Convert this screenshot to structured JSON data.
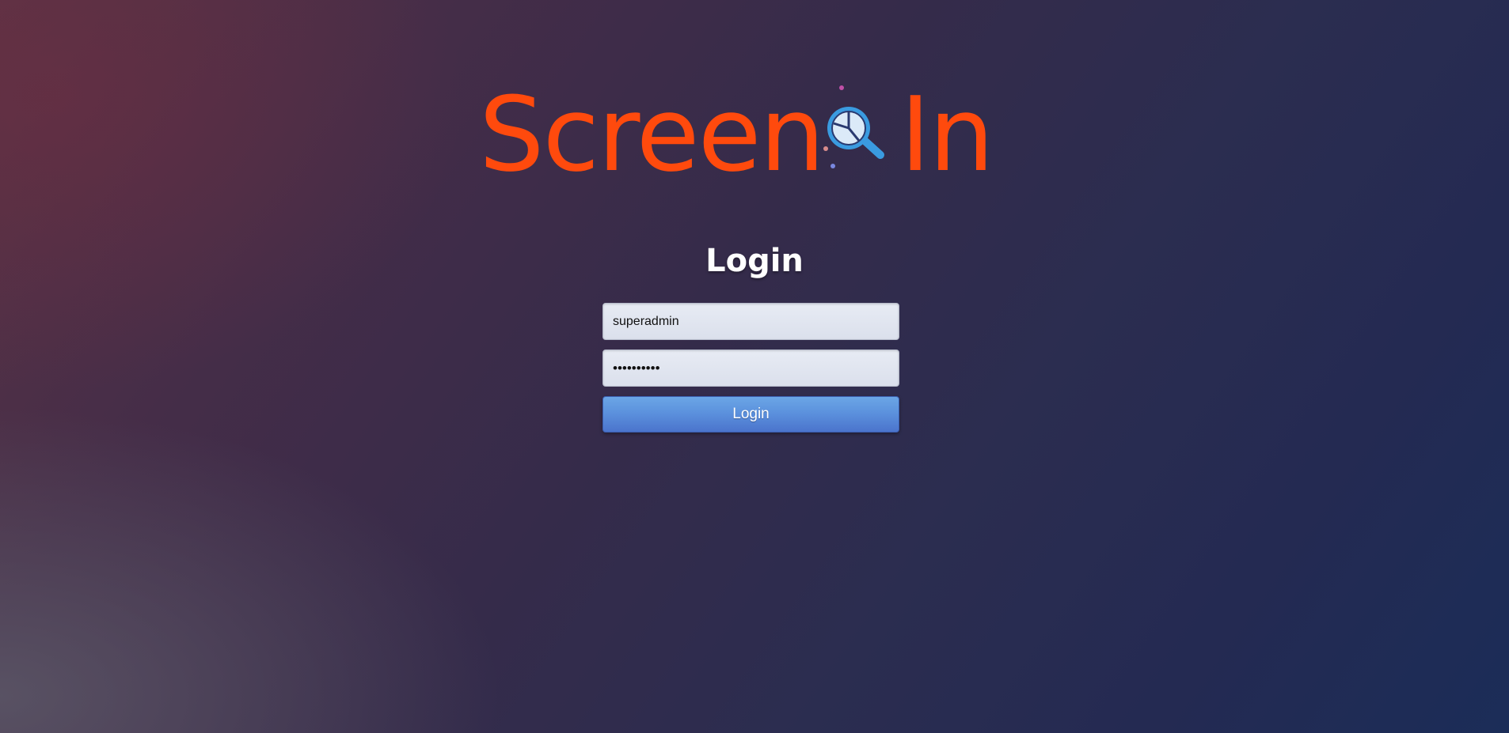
{
  "brand": {
    "word_left": "Screen",
    "word_right": "In",
    "logo_color": "#ff4a0d",
    "icon": "magnifier-pie-chart-icon"
  },
  "login": {
    "title": "Login",
    "username_value": "superadmin",
    "password_value": "••••••••••",
    "button_label": "Login",
    "button_color": "#5a8fdc"
  }
}
